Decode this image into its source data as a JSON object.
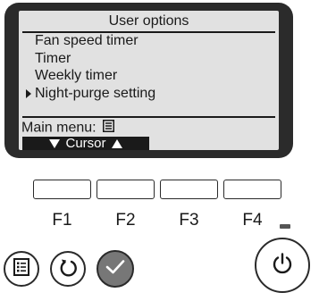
{
  "screen": {
    "title": "User options",
    "menu_items": [
      {
        "label": "Fan speed timer",
        "selected": false
      },
      {
        "label": "Timer",
        "selected": false
      },
      {
        "label": "Weekly timer",
        "selected": false
      },
      {
        "label": "Night-purge setting",
        "selected": true
      }
    ],
    "main_menu_label": "Main menu:",
    "main_menu_icon": "menu-icon",
    "cursor_label": "Cursor"
  },
  "function_buttons": [
    "F1",
    "F2",
    "F3",
    "F4"
  ],
  "round_buttons": {
    "menu": "menu-icon",
    "return": "return-icon",
    "confirm": "check-icon",
    "power": "power-icon"
  },
  "colors": {
    "screen_frame": "#2b2b2b",
    "lcd_background": "#e1e1e1",
    "confirm_button": "#777777",
    "power_led": "#555555"
  }
}
